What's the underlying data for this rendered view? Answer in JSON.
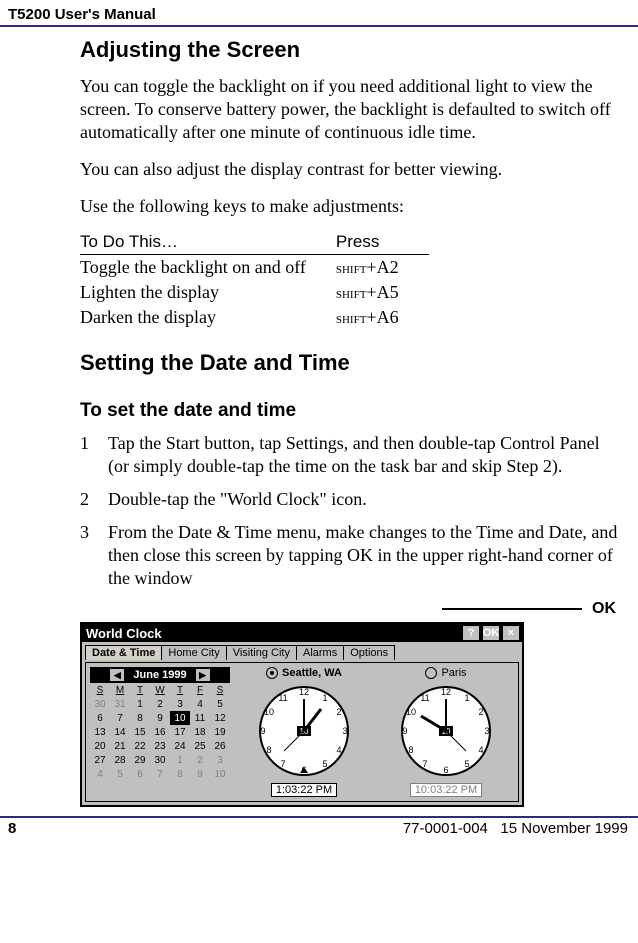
{
  "running_head": "T5200 User's Manual",
  "section1": {
    "title": "Adjusting the Screen",
    "p1": "You can toggle the backlight on if you need additional light to view the screen. To conserve battery power, the backlight is defaulted to switch off automatically after one minute of continuous idle time.",
    "p2": "You can also adjust the display contrast for better viewing.",
    "p3": "Use the following keys to make adjustments:",
    "table": {
      "headers": [
        "To Do This…",
        "Press"
      ],
      "rows": [
        {
          "action": "Toggle the backlight on and off",
          "mod": "shift",
          "key": "+A2"
        },
        {
          "action": "Lighten the display",
          "mod": "shift",
          "key": "+A5"
        },
        {
          "action": "Darken the display",
          "mod": "shift",
          "key": "+A6"
        }
      ]
    }
  },
  "section2": {
    "title": "Setting the Date and Time",
    "sub": "To set the date and time",
    "steps": [
      "Tap the Start button, tap Settings, and then double-tap Control Panel (or simply double-tap the time on the task bar and skip Step 2).",
      "Double-tap the \"World Clock\" icon.",
      "From the Date & Time menu,  make changes to the Time and Date, and then close this screen by tapping OK in the upper right-hand corner of the window"
    ]
  },
  "callout_ok": "OK",
  "world_clock": {
    "title": "World Clock",
    "btn_help": "?",
    "btn_ok": "OK",
    "btn_close": "×",
    "tabs": [
      "Date & Time",
      "Home City",
      "Visiting City",
      "Alarms",
      "Options"
    ],
    "month": "June 1999",
    "dow": [
      "S",
      "M",
      "T",
      "W",
      "T",
      "F",
      "S"
    ],
    "weeks": [
      [
        "30",
        "31",
        "1",
        "2",
        "3",
        "4",
        "5"
      ],
      [
        "6",
        "7",
        "8",
        "9",
        "10",
        "11",
        "12"
      ],
      [
        "13",
        "14",
        "15",
        "16",
        "17",
        "18",
        "19"
      ],
      [
        "20",
        "21",
        "22",
        "23",
        "24",
        "25",
        "26"
      ],
      [
        "27",
        "28",
        "29",
        "30",
        "1",
        "2",
        "3"
      ],
      [
        "4",
        "5",
        "6",
        "7",
        "8",
        "9",
        "10"
      ]
    ],
    "selected_day": "10",
    "city1": "Seattle, WA",
    "city2": "Paris",
    "time1": "1:03:22 PM",
    "time2": "10:03:22 PM",
    "clock_date": "10"
  },
  "footer": {
    "page": "8",
    "docnum": "77-0001-004",
    "date": "15 November 1999"
  }
}
